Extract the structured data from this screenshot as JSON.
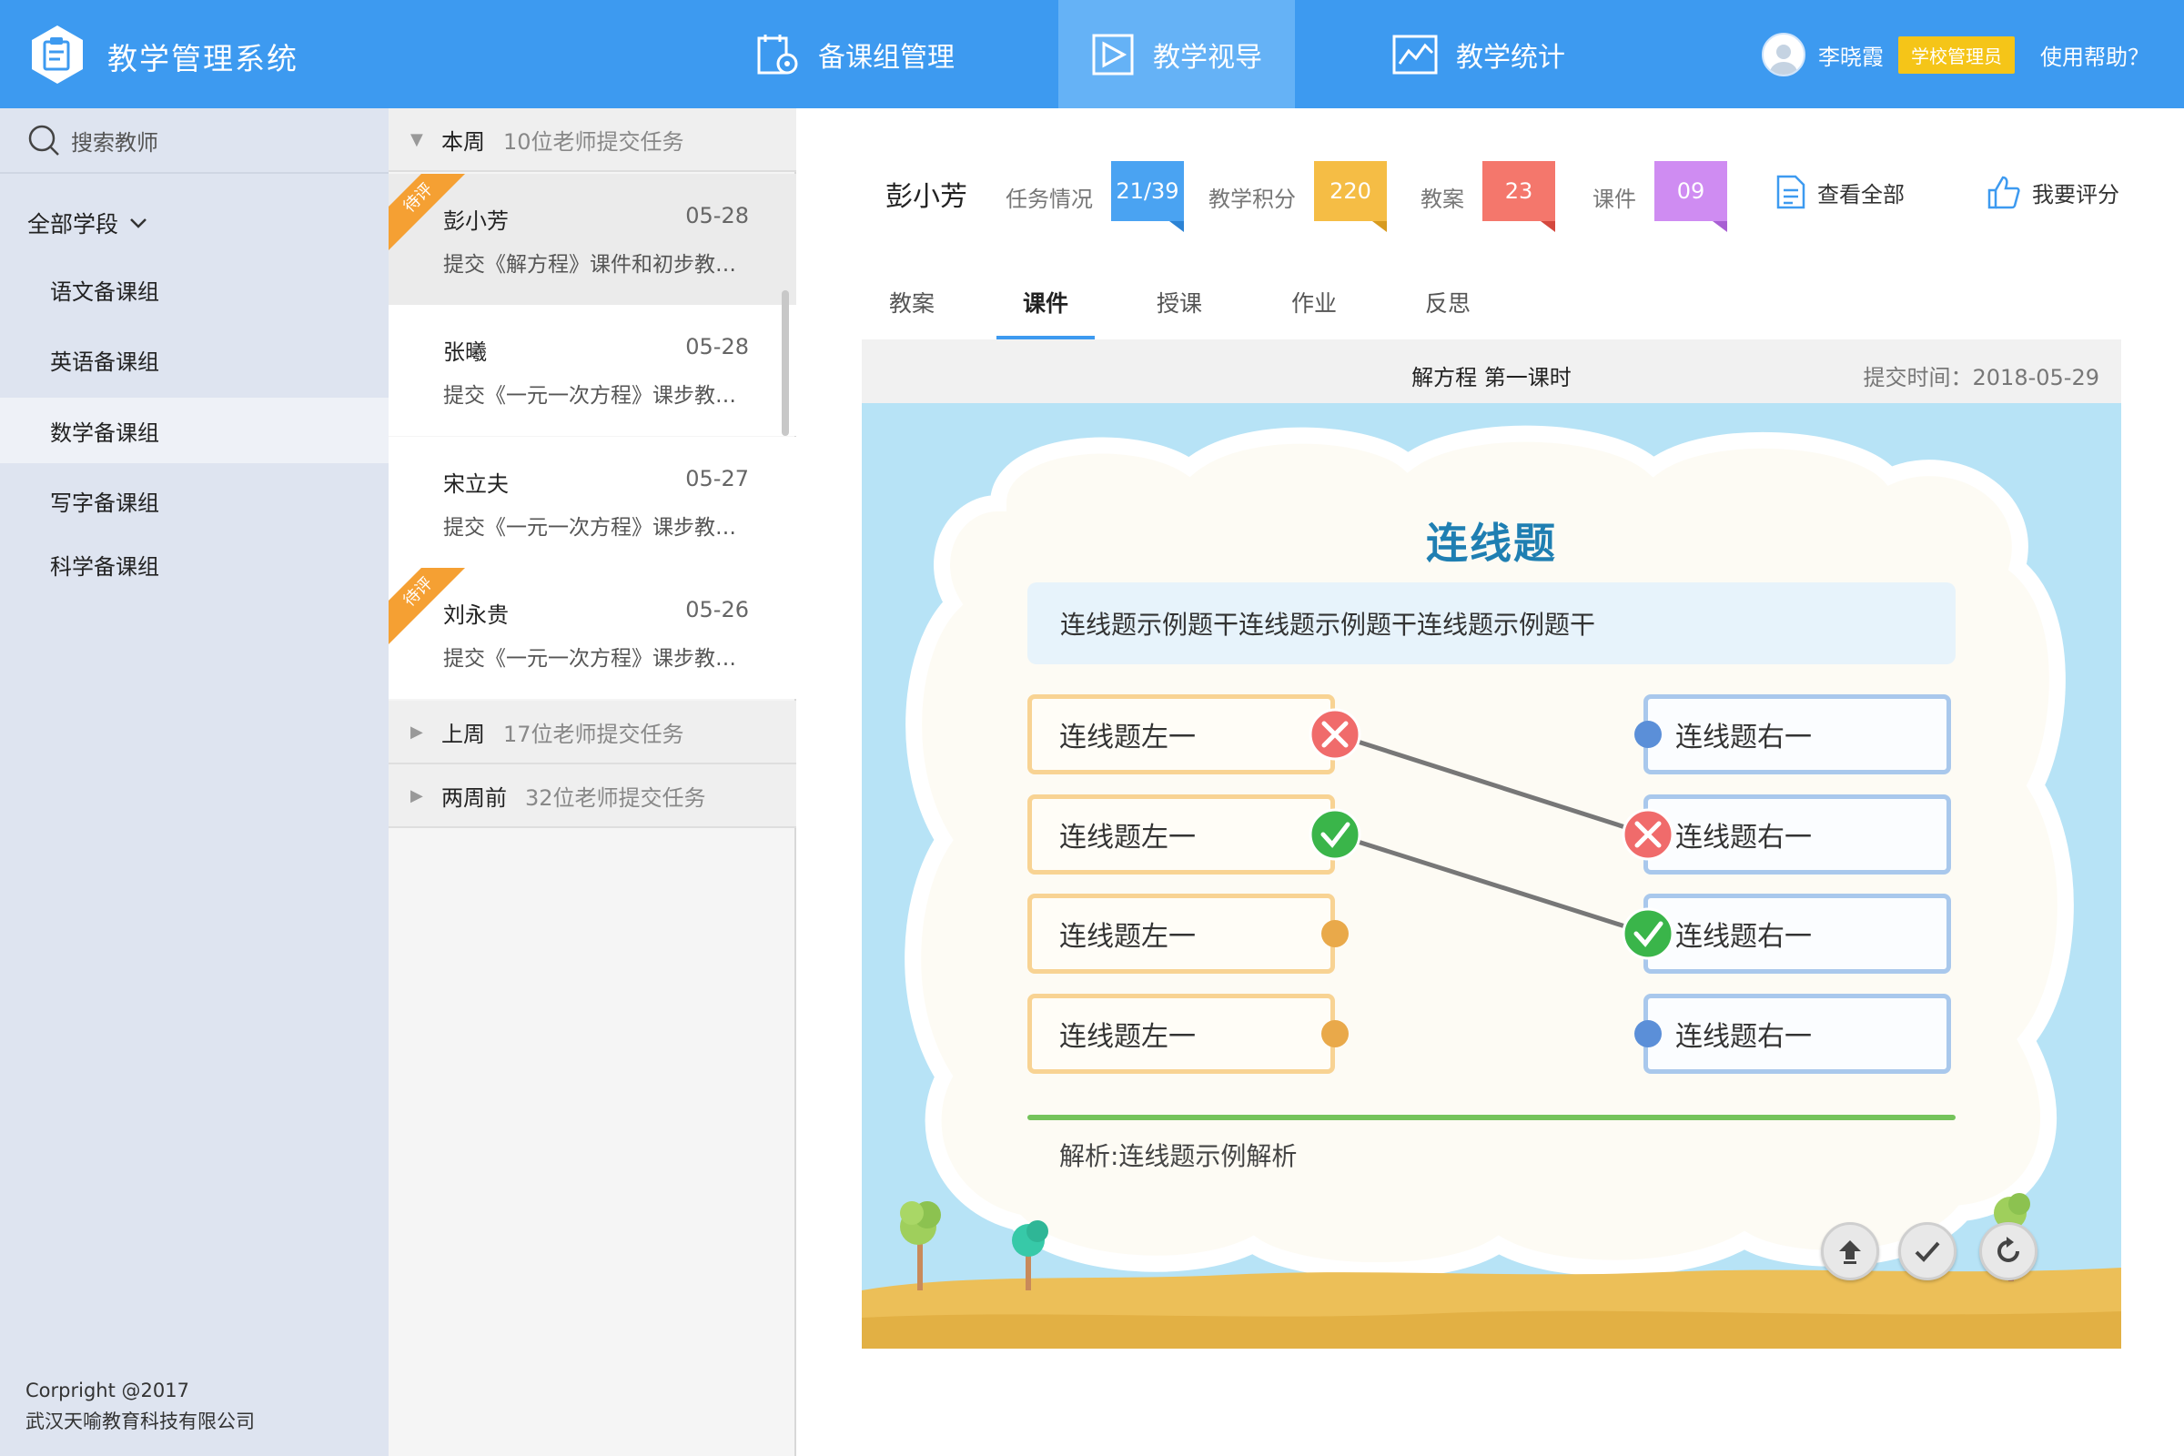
{
  "app": {
    "title": "教学管理系统"
  },
  "nav": [
    {
      "label": "备课组管理",
      "icon": "calendar-icon"
    },
    {
      "label": "教学视导",
      "icon": "play-icon",
      "active": true
    },
    {
      "label": "教学统计",
      "icon": "line-chart-icon"
    }
  ],
  "user": {
    "name": "李晓霞",
    "role": "学校管理员",
    "help": "使用帮助？"
  },
  "sidebar": {
    "search_label": "搜索教师",
    "stage_filter": "全部学段",
    "groups": [
      {
        "label": "语文备课组"
      },
      {
        "label": "英语备课组"
      },
      {
        "label": "数学备课组",
        "active": true
      },
      {
        "label": "写字备课组"
      },
      {
        "label": "科学备课组"
      }
    ],
    "copyright_line1": "Corpright @2017",
    "copyright_line2": "武汉天喻教育科技有限公司"
  },
  "tasks": {
    "this_week": {
      "label": "本周",
      "count": "10位老师提交任务"
    },
    "items": [
      {
        "name": "彭小芳",
        "date": "05-28",
        "desc": "提交《解方程》课件和初步教学设计",
        "ribbon": "待评",
        "active": true
      },
      {
        "name": "张曦",
        "date": "05-28",
        "desc": "提交《一元一次方程》课步教学设计",
        "ribbon": ""
      },
      {
        "name": "宋立夫",
        "date": "05-27",
        "desc": "提交《一元一次方程》课步教学设计",
        "ribbon": ""
      },
      {
        "name": "刘永贵",
        "date": "05-26",
        "desc": "提交《一元一次方程》课步教学设计",
        "ribbon": "待评"
      }
    ],
    "last_week": {
      "label": "上周",
      "count": "17位老师提交任务"
    },
    "two_weeks": {
      "label": "两周前",
      "count": "32位老师提交任务"
    }
  },
  "teacher": {
    "name": "彭小芳",
    "stats": [
      {
        "label": "任务情况",
        "value": "21/39",
        "color": "#4aa3f2",
        "shade": "#2c83d4"
      },
      {
        "label": "教学积分",
        "value": "220",
        "color": "#f5bd45",
        "shade": "#d79a1e"
      },
      {
        "label": "教案",
        "value": "23",
        "color": "#f4776c",
        "shade": "#d4483e"
      },
      {
        "label": "课件",
        "value": "09",
        "color": "#cf8cf2",
        "shade": "#a85fd3"
      }
    ],
    "view_all": "查看全部",
    "rate": "我要评分"
  },
  "tabs": [
    {
      "label": "教案"
    },
    {
      "label": "课件",
      "active": true
    },
    {
      "label": "授课"
    },
    {
      "label": "作业"
    },
    {
      "label": "反思"
    }
  ],
  "doc": {
    "title": "解方程 第一课时",
    "time": "提交时间：2018-05-29"
  },
  "question": {
    "title": "连线题",
    "stem": "连线题示例题干连线题示例题干连线题示例题干",
    "left": [
      "连线题左一",
      "连线题左一",
      "连线题左一",
      "连线题左一"
    ],
    "right": [
      "连线题右一",
      "连线题右一",
      "连线题右一",
      "连线题右一"
    ],
    "analysis": "解析:连线题示例解析"
  },
  "colors": {
    "primary": "#3d9af0",
    "wrong": "#f06b6b",
    "correct": "#3ab54a",
    "left_dot": "#e9a94a",
    "right_dot": "#5b8fd8"
  }
}
